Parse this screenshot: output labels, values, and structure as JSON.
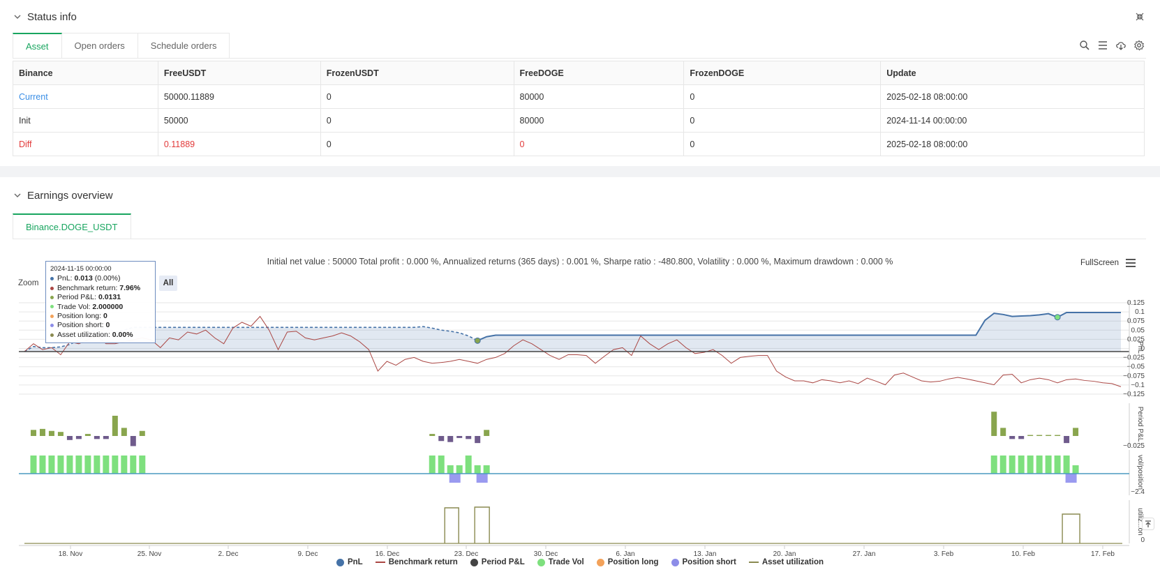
{
  "status": {
    "title": "Status info",
    "tabs": [
      "Asset",
      "Open orders",
      "Schedule orders"
    ],
    "table": {
      "headers": [
        "Binance",
        "FreeUSDT",
        "FrozenUSDT",
        "FreeDOGE",
        "FrozenDOGE",
        "Update"
      ],
      "rows": [
        [
          "Current",
          "50000.11889",
          "0",
          "80000",
          "0",
          "2025-02-18 08:00:00"
        ],
        [
          "Init",
          "50000",
          "0",
          "80000",
          "0",
          "2024-11-14 00:00:00"
        ],
        [
          "Diff",
          "0.11889",
          "0",
          "0",
          "0",
          "2025-02-18 08:00:00"
        ]
      ]
    }
  },
  "earnings": {
    "title": "Earnings overview",
    "tab": "Binance.DOGE_USDT",
    "summary": "Initial net value : 50000 Total profit : 0.000 %, Annualized returns (365 days) : 0.001 %, Sharpe ratio : -480.800, Volatility : 0.000 %, Maximum drawdown : 0.000 %",
    "fullscreen": "FullScreen",
    "zoom_label": "Zoom",
    "zoom_all": "All",
    "tooltip": {
      "date": "2024-11-15 00:00:00",
      "rows": [
        {
          "label": "PnL: ",
          "value": "0.013",
          "extra": " (0.00%)",
          "color": "#4572a7"
        },
        {
          "label": "Benchmark return: ",
          "value": "7.96%",
          "extra": "",
          "color": "#aa4643"
        },
        {
          "label": "Period P&L: ",
          "value": "0.0131",
          "extra": "",
          "color": "#89a54e"
        },
        {
          "label": "Trade Vol: ",
          "value": "2.000000",
          "extra": "",
          "color": "#7ee07e"
        },
        {
          "label": "Position long: ",
          "value": "0",
          "extra": "",
          "color": "#f3a25a"
        },
        {
          "label": "Position short: ",
          "value": "0",
          "extra": "",
          "color": "#8d8de8"
        },
        {
          "label": "Asset utilization: ",
          "value": "0.00%",
          "extra": "",
          "color": "#8a8a50"
        }
      ]
    },
    "legend": [
      {
        "name": "PnL",
        "type": "dot",
        "color": "#4572a7"
      },
      {
        "name": "Benchmark return",
        "type": "line",
        "color": "#aa4643"
      },
      {
        "name": "Period P&L",
        "type": "dot",
        "color": "#444444"
      },
      {
        "name": "Trade Vol",
        "type": "dot",
        "color": "#7ee07e"
      },
      {
        "name": "Position long",
        "type": "dot",
        "color": "#f3a25a"
      },
      {
        "name": "Position short",
        "type": "dot",
        "color": "#8d8de8"
      },
      {
        "name": "Asset utilization",
        "type": "line",
        "color": "#8a8a50"
      }
    ],
    "x_ticks": [
      "18. Nov",
      "25. Nov",
      "2. Dec",
      "9. Dec",
      "16. Dec",
      "23. Dec",
      "30. Dec",
      "6. Jan",
      "13. Jan",
      "20. Jan",
      "27. Jan",
      "3. Feb",
      "10. Feb",
      "17. Feb"
    ],
    "y_ticks_main": [
      "0.125",
      "0.1",
      "0.075",
      "0.05",
      "0.025",
      "0",
      "−0.025",
      "−0.05",
      "−0.075",
      "−0.1",
      "−0.125"
    ],
    "y_tick_period": "−0.025",
    "y_tick_vol": "−2.4",
    "y_tick_util": "0",
    "axis_titles": [
      "PnL",
      "Period P&L",
      "vol/position",
      "utiliz...on"
    ]
  },
  "chart_data": {
    "type": "line",
    "pnl": [
      0,
      0.013,
      0.01,
      0.01,
      0.012,
      0.018,
      0.03,
      0.05,
      0.055,
      0.06,
      0.05,
      0.055,
      0.062,
      0.062,
      0.062,
      0.062,
      0.062,
      0.062,
      0.062,
      0.062,
      0.062,
      0.062,
      0.062,
      0.062,
      0.062,
      0.062,
      0.062,
      0.062,
      0.062,
      0.062,
      0.062,
      0.062,
      0.062,
      0.062,
      0.062,
      0.062,
      0.062,
      0.062,
      0.062,
      0.062,
      0.062,
      0.062,
      0.062,
      0.062,
      0.064,
      0.06,
      0.055,
      0.052,
      0.048,
      0.04,
      0.028,
      0.038,
      0.042,
      0.042,
      0.042,
      0.042,
      0.042,
      0.042,
      0.042,
      0.042,
      0.042,
      0.042,
      0.042,
      0.042,
      0.042,
      0.042,
      0.042,
      0.042,
      0.042,
      0.042,
      0.042,
      0.042,
      0.042,
      0.042,
      0.042,
      0.042,
      0.042,
      0.042,
      0.042,
      0.042,
      0.042,
      0.042,
      0.042,
      0.042,
      0.042,
      0.042,
      0.042,
      0.042,
      0.042,
      0.042,
      0.042,
      0.042,
      0.042,
      0.042,
      0.042,
      0.042,
      0.042,
      0.042,
      0.042,
      0.042,
      0.042,
      0.042,
      0.042,
      0.042,
      0.042,
      0.042,
      0.08,
      0.098,
      0.095,
      0.09,
      0.091,
      0.092,
      0.094,
      0.097,
      0.088,
      0.1,
      0.1,
      0.1,
      0.1,
      0.1,
      0.1,
      0.1
    ],
    "benchmark": [
      0,
      0.02,
      0.005,
      0.01,
      -0.008,
      0.025,
      0.02,
      0.03,
      0.04,
      0.02,
      0.02,
      0.025,
      0.03,
      0.035,
      0.03,
      0.01,
      0.035,
      0.03,
      0.05,
      0.045,
      0.055,
      0.035,
      0.02,
      0.06,
      0.075,
      0.065,
      0.09,
      0.055,
      0.005,
      0.05,
      0.052,
      0.035,
      0.03,
      0.035,
      0.04,
      0.048,
      0.04,
      0.025,
      0.005,
      -0.05,
      -0.025,
      -0.035,
      -0.02,
      -0.015,
      -0.025,
      -0.03,
      -0.028,
      -0.025,
      -0.02,
      -0.025,
      -0.03,
      -0.02,
      -0.015,
      -0.005,
      0.015,
      0.03,
      0.02,
      0.005,
      -0.01,
      -0.02,
      -0.008,
      -0.008,
      -0.01,
      -0.03,
      -0.012,
      0.005,
      0.01,
      -0.01,
      0.04,
      0.02,
      0.005,
      0.02,
      0.03,
      0.01,
      -0.005,
      -0.002,
      0.005,
      -0.01,
      -0.03,
      -0.015,
      -0.012,
      -0.01,
      -0.01,
      -0.05,
      -0.065,
      -0.075,
      -0.075,
      -0.08,
      -0.072,
      -0.075,
      -0.08,
      -0.075,
      -0.082,
      -0.068,
      -0.076,
      -0.085,
      -0.06,
      -0.055,
      -0.065,
      -0.075,
      -0.078,
      -0.076,
      -0.07,
      -0.066,
      -0.07,
      -0.075,
      -0.08,
      -0.085,
      -0.06,
      -0.058,
      -0.08,
      -0.072,
      -0.068,
      -0.072,
      -0.08,
      -0.072,
      -0.07,
      -0.074,
      -0.076,
      -0.08,
      -0.082,
      -0.09
    ]
  }
}
